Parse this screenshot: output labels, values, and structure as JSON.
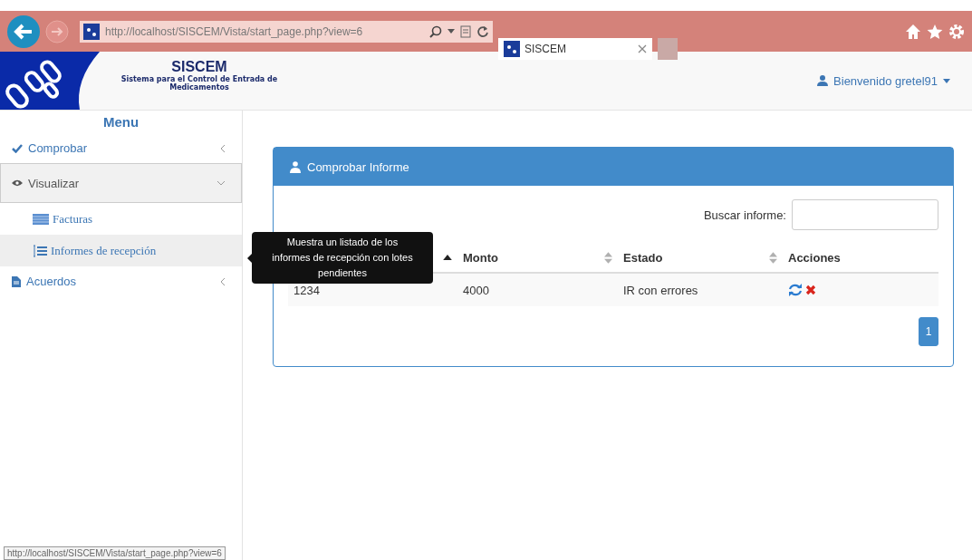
{
  "browser": {
    "url": "http://localhost/SISCEM/Vista/start_page.php?view=6",
    "tab_title": "SISCEM",
    "status_url": "http://localhost/SISCEM/Vista/start_page.php?view=6"
  },
  "header": {
    "title": "SISCEM",
    "subtitle": "Sistema para el Control de Entrada de Medicamentos",
    "user": "Bienvenido gretel91"
  },
  "menu": {
    "title": "Menu",
    "items": [
      {
        "label": "Comprobar",
        "expanded": false
      },
      {
        "label": "Visualizar",
        "expanded": true,
        "children": [
          {
            "label": "Facturas",
            "selected": false
          },
          {
            "label": "Informes de recepción",
            "selected": true
          }
        ]
      },
      {
        "label": "Acuerdos",
        "expanded": false
      }
    ]
  },
  "panel": {
    "title": "Comprobar Informe",
    "search_label": "Buscar informe:",
    "columns": [
      {
        "sortable": true,
        "sorted": true
      },
      {
        "label": "Monto",
        "sortable": true,
        "sorted": false
      },
      {
        "label": "Estado",
        "sortable": true,
        "sorted": false
      },
      {
        "label": "Acciones",
        "sortable": false
      }
    ],
    "rows": [
      {
        "cells": [
          "1234",
          "4000",
          "IR con errores"
        ]
      }
    ],
    "pages": [
      {
        "label": "1",
        "selected": true
      }
    ]
  },
  "tooltip": {
    "text": "Muestra un listado de los informes de recepción con lotes pendientes"
  }
}
